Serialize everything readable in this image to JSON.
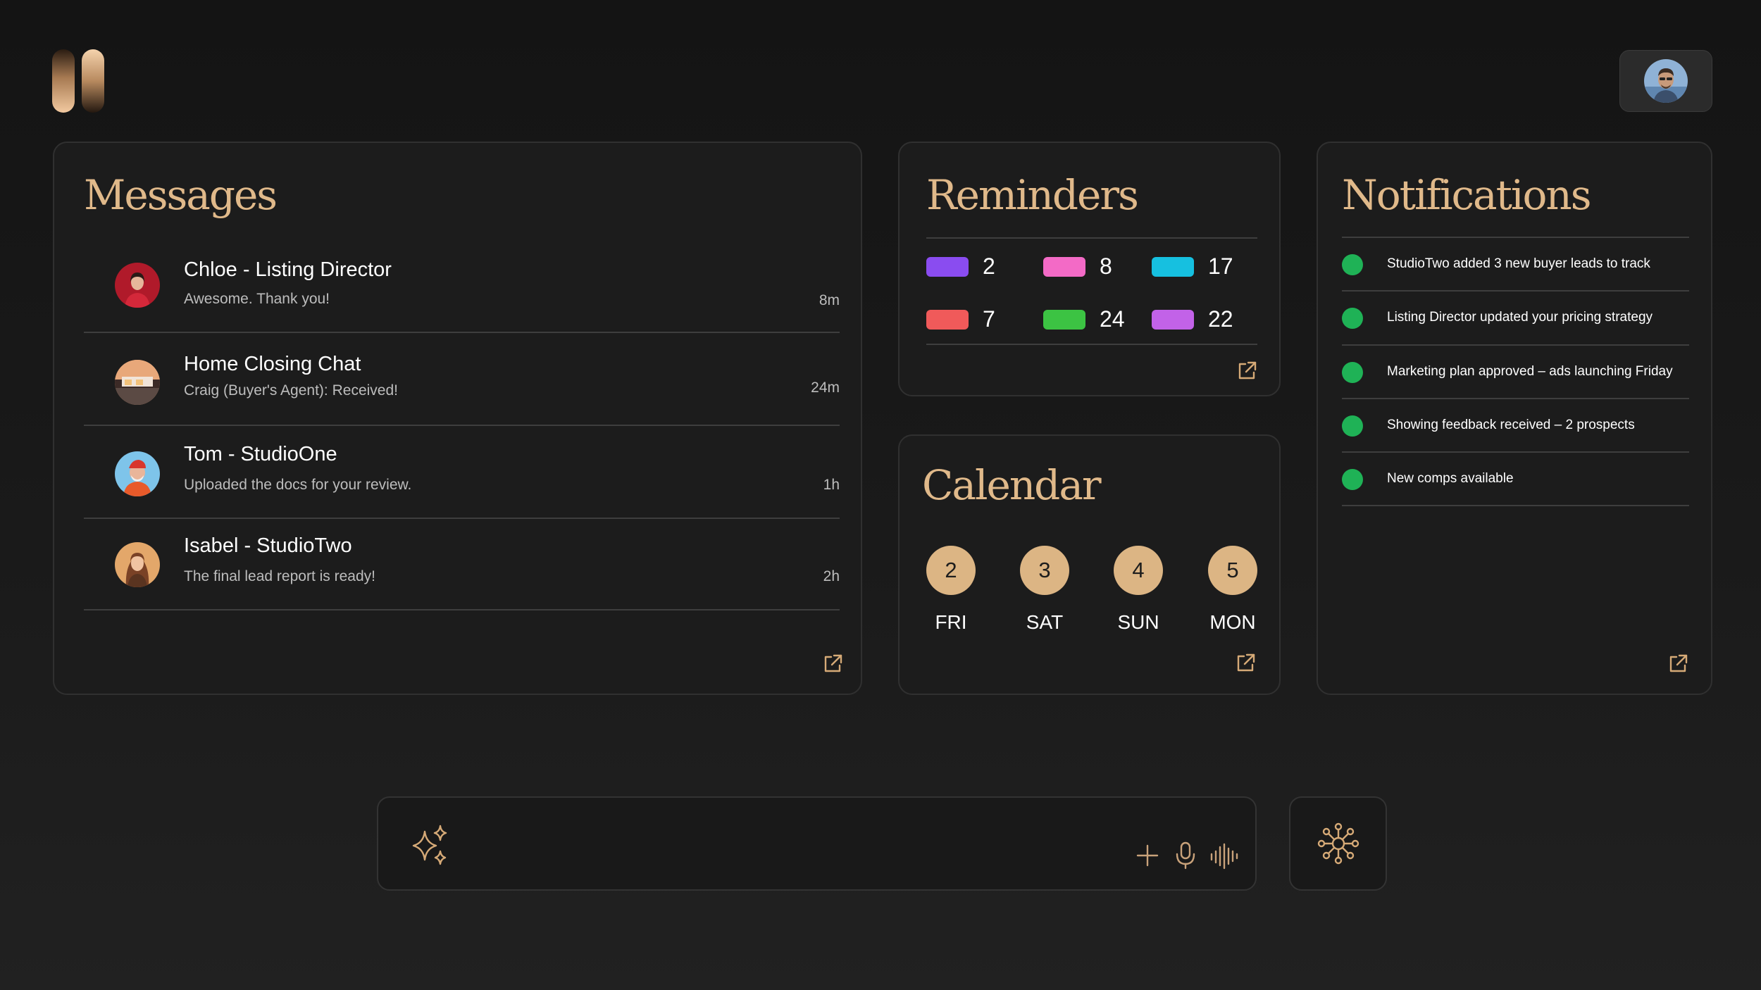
{
  "messages": {
    "title": "Messages",
    "items": [
      {
        "name": "Chloe - Listing Director",
        "preview": "Awesome. Thank you!",
        "time": "8m"
      },
      {
        "name": "Home Closing Chat",
        "preview": "Craig (Buyer's Agent):  Received!",
        "time": "24m"
      },
      {
        "name": "Tom - StudioOne",
        "preview": "Uploaded the docs for your review.",
        "time": "1h"
      },
      {
        "name": "Isabel - StudioTwo",
        "preview": "The final lead report is ready!",
        "time": "2h"
      }
    ]
  },
  "reminders": {
    "title": "Reminders",
    "items": [
      {
        "color": "#8a4cf0",
        "count": "2"
      },
      {
        "color": "#f36ac6",
        "count": "8"
      },
      {
        "color": "#16c0e0",
        "count": "17"
      },
      {
        "color": "#f05a5a",
        "count": "7"
      },
      {
        "color": "#3cc343",
        "count": "24"
      },
      {
        "color": "#c262e8",
        "count": "22"
      }
    ]
  },
  "calendar": {
    "title": "Calendar",
    "days": [
      {
        "date": "2",
        "day": "FRI"
      },
      {
        "date": "3",
        "day": "SAT"
      },
      {
        "date": "4",
        "day": "SUN"
      },
      {
        "date": "5",
        "day": "MON"
      }
    ]
  },
  "notifications": {
    "title": "Notifications",
    "status_color": "#1fb256",
    "items": [
      "StudioTwo added 3 new buyer leads to track",
      "Listing Director updated your pricing strategy",
      "Marketing plan approved – ads launching Friday",
      "Showing feedback received – 2 prospects",
      "New comps available"
    ]
  },
  "icons": {
    "logo": "app-logo",
    "avatar": "user-avatar",
    "external": "external-link-icon",
    "sparkle": "sparkle-icon",
    "plus": "plus-icon",
    "mic": "microphone-icon",
    "waveform": "waveform-icon",
    "hub": "network-hub-icon"
  },
  "colors": {
    "accent": "#e0b98a",
    "card_bg": "#1c1c1c",
    "page_bg": "#171717"
  }
}
